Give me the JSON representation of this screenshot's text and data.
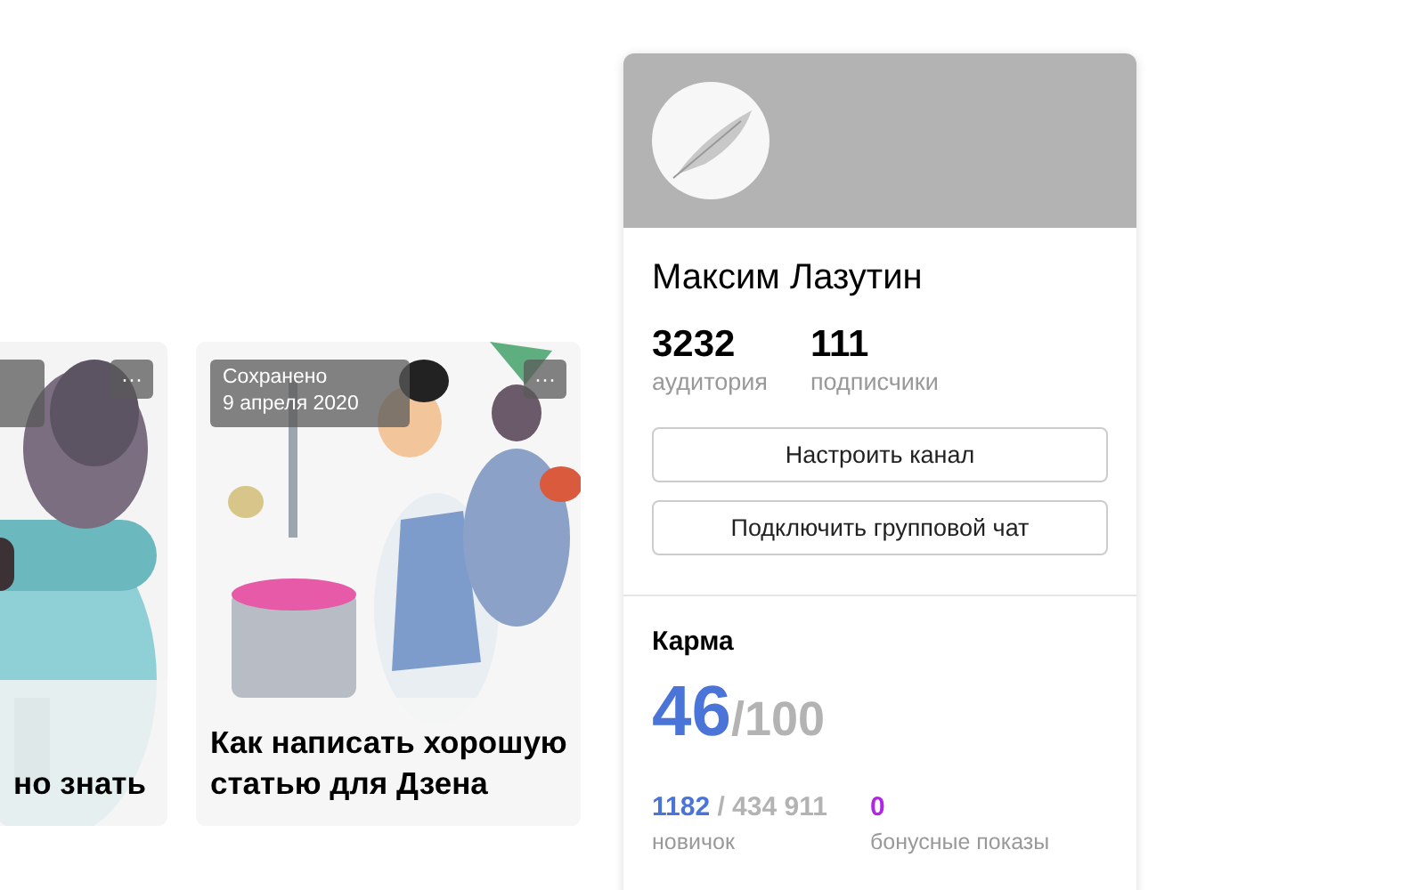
{
  "cards": [
    {
      "badge_shown": true,
      "more": "···",
      "title": "но знать"
    },
    {
      "badge_shown": true,
      "badge_lines": [
        "Сохранено",
        "9 апреля 2020"
      ],
      "more": "···",
      "title": "Как написать хорошую статью для Дзена"
    }
  ],
  "profile": {
    "name": "Максим Лазутин",
    "stats": [
      {
        "value": "3232",
        "label": "аудитория"
      },
      {
        "value": "111",
        "label": "подписчики"
      }
    ],
    "buttons": [
      "Настроить канал",
      "Подключить групповой чат"
    ],
    "karma": {
      "title": "Карма",
      "score": "46",
      "max": "/100",
      "progress": "1182",
      "total": "/ 434 911",
      "rank": "новичок",
      "bonus": "0",
      "bonus_label": "бонусные показы"
    }
  }
}
